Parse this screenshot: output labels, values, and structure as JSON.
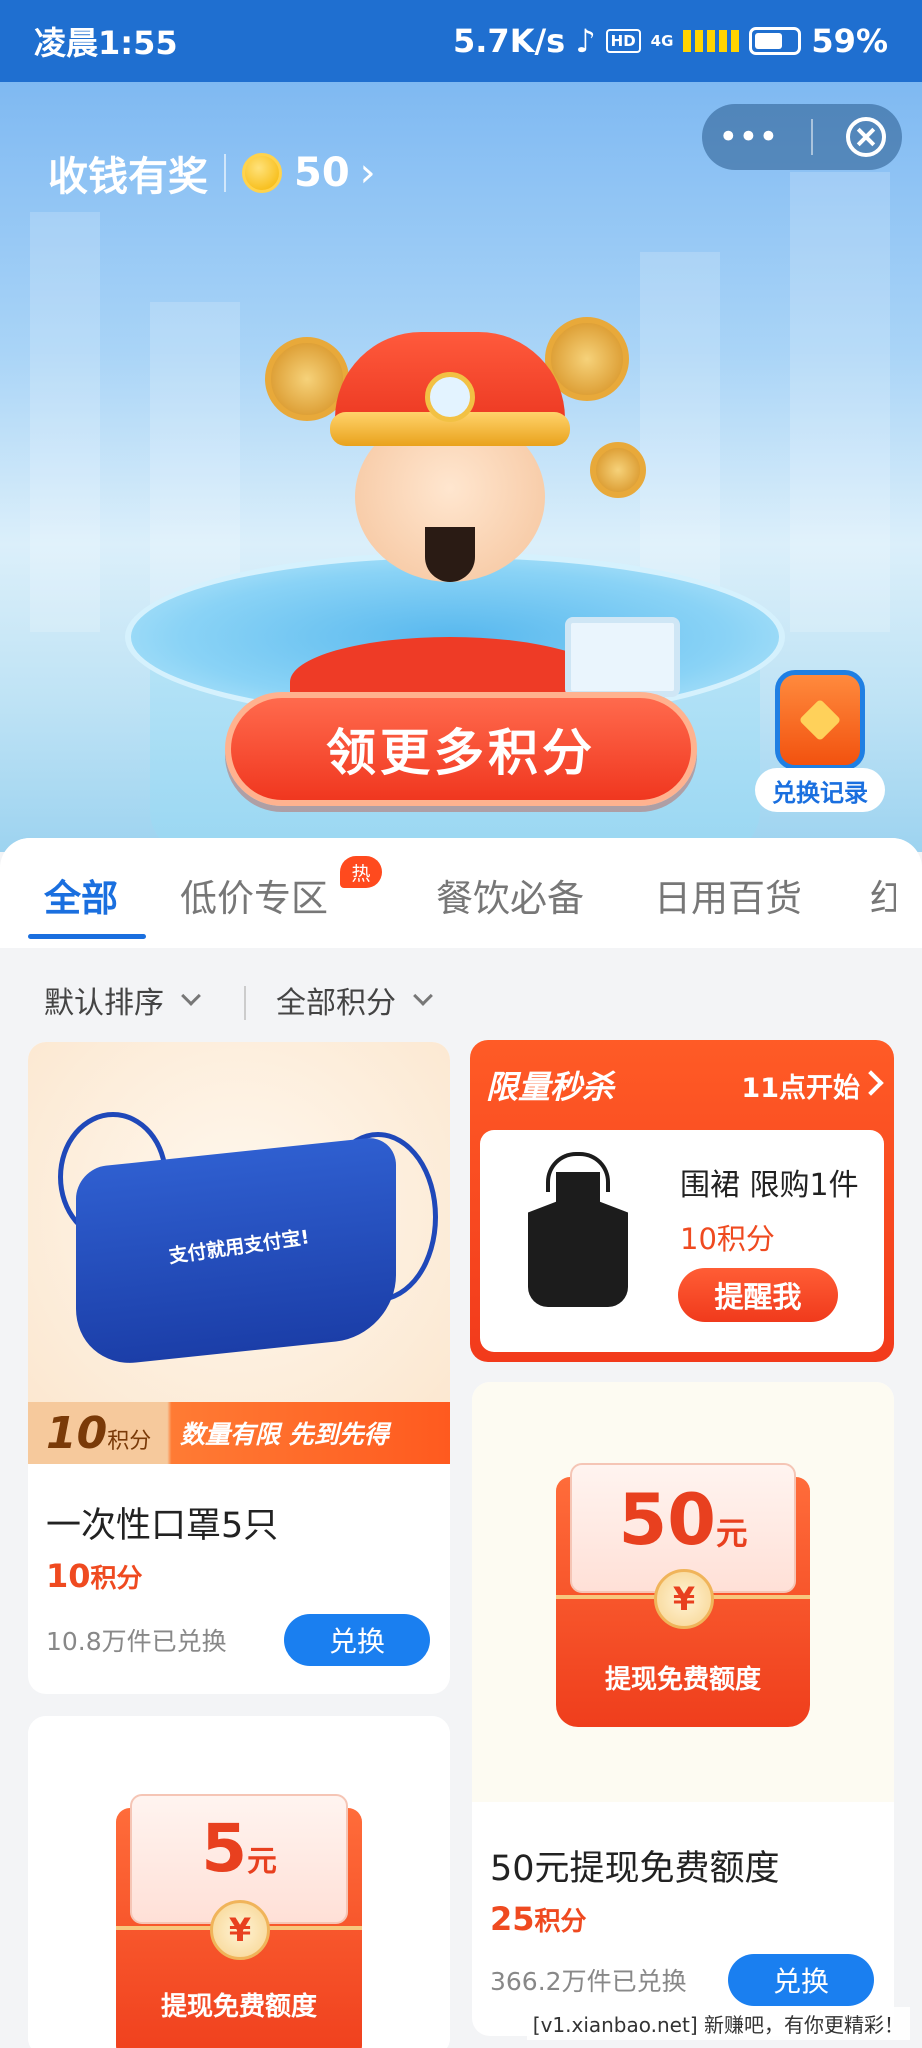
{
  "status_bar": {
    "time": "凌晨1:55",
    "speed": "5.7K/s",
    "hd": "HD",
    "network": "4G",
    "battery": "59%"
  },
  "header": {
    "title": "收钱有奖",
    "points": "50",
    "chevron": "›",
    "menu_dots": "•••"
  },
  "hero": {
    "cta_label": "领更多积分",
    "record_label": "兑换记录"
  },
  "tabs": [
    {
      "label": "全部"
    },
    {
      "label": "低价专区",
      "badge": "热"
    },
    {
      "label": "餐饮必备"
    },
    {
      "label": "日用百货"
    },
    {
      "label": "红"
    }
  ],
  "filters": {
    "sort": "默认排序",
    "points": "全部积分"
  },
  "products": [
    {
      "promo_points": "10",
      "promo_points_unit": "积分",
      "promo_text": "数量有限  先到先得",
      "image_text": "支付就用支付宝!",
      "title": "一次性口罩5只",
      "points": "10",
      "points_unit": "积分",
      "count": "10.8万件已兑换",
      "button": "兑换"
    },
    {
      "amount": "50",
      "amount_unit": "元",
      "coin": "¥",
      "envelope_label": "提现免费额度",
      "title": "50元提现免费额度",
      "points": "25",
      "points_unit": "积分",
      "count": "366.2万件已兑换",
      "button": "兑换"
    },
    {
      "amount": "5",
      "amount_unit": "元",
      "coin": "¥",
      "envelope_label": "提现免费额度"
    }
  ],
  "flash_sale": {
    "title": "限量秒杀",
    "time": "11点开始",
    "item_name": "围裙 限购1件",
    "item_points": "10积分",
    "button": "提醒我"
  },
  "watermark": "[v1.xianbao.net] 新赚吧，有你更精彩！",
  "colors": {
    "primary_blue": "#1a7ff0",
    "accent_red": "#ef4a20",
    "status_bar": "#1f6fd0"
  }
}
